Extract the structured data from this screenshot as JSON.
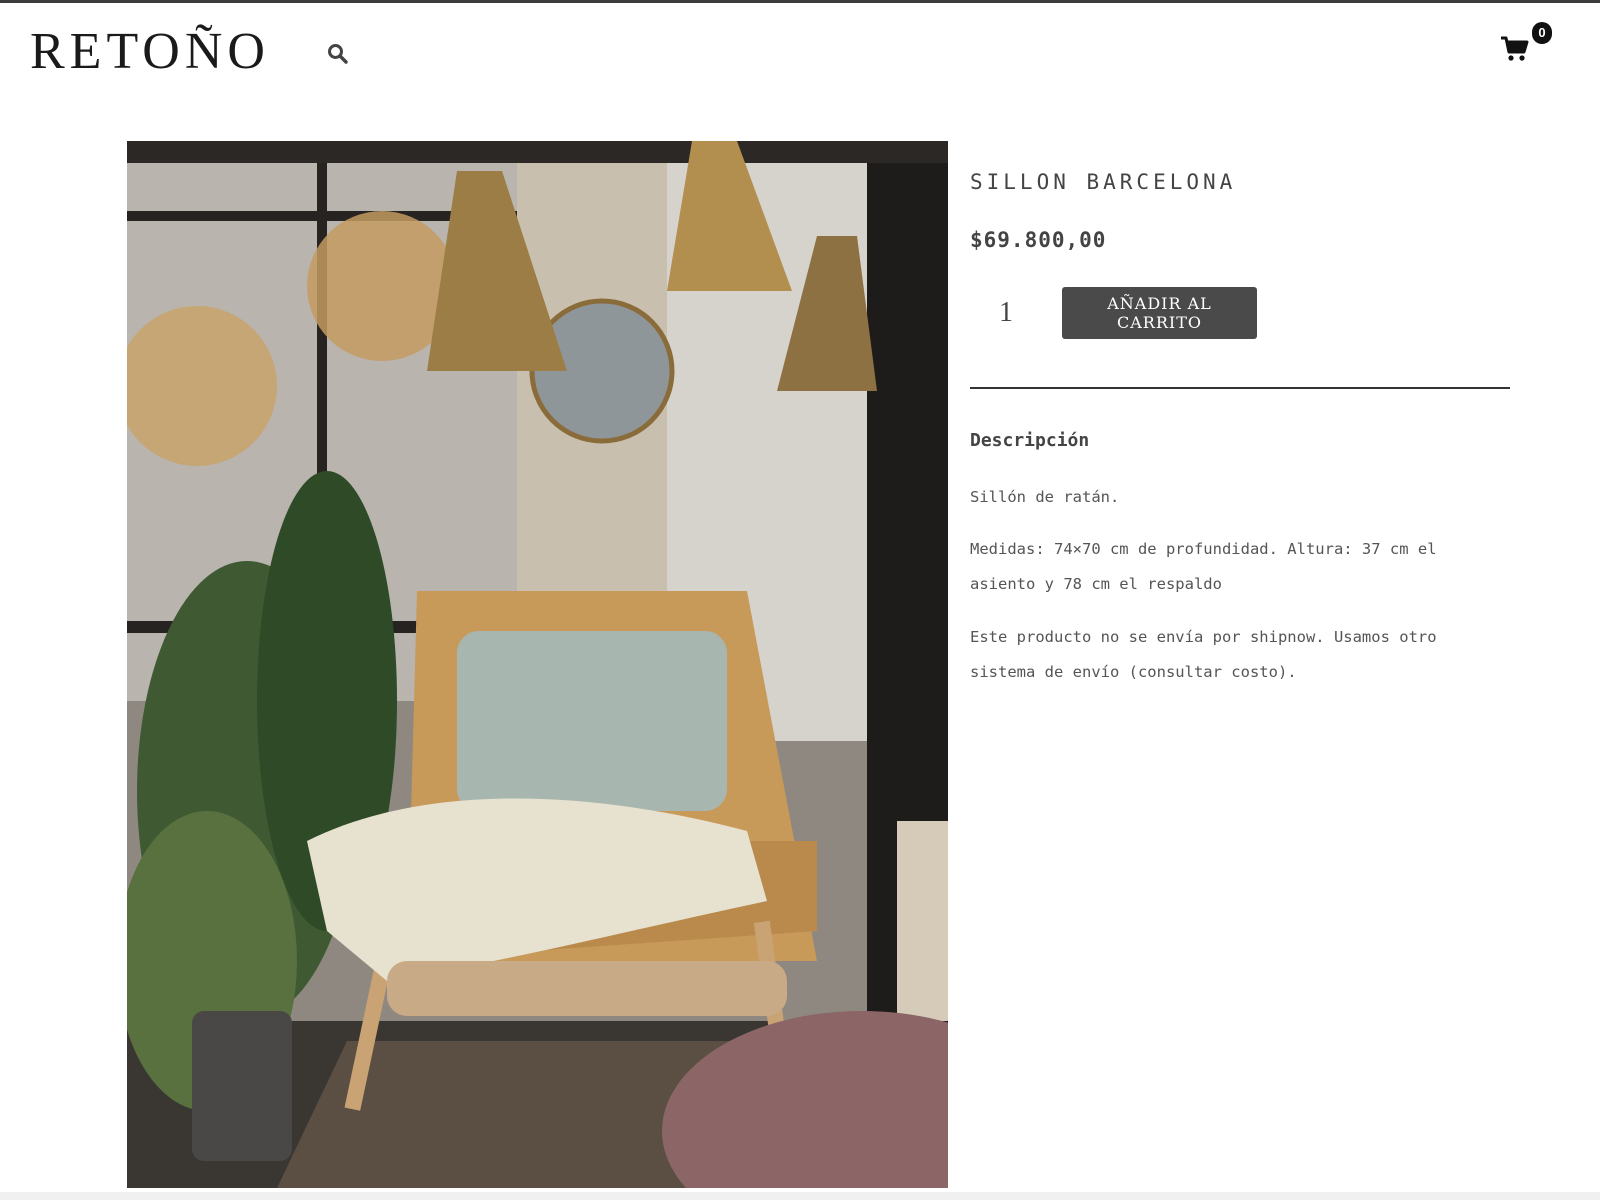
{
  "header": {
    "logo": "RETOÑO",
    "search_icon": "search-icon",
    "cart_icon": "cart-icon",
    "cart_count": "0"
  },
  "product": {
    "title": "SILLON BARCELONA",
    "price": "$69.800,00",
    "quantity": "1",
    "add_to_cart_label": "AÑADIR AL CARRITO",
    "image_alt": ""
  },
  "description": {
    "heading": "Descripción",
    "paragraphs": [
      "Sillón de ratán.",
      "Medidas: 74×70 cm de profundidad. Altura: 37 cm el asiento y 78 cm el respaldo",
      "Este producto no se envía por shipnow. Usamos otro sistema de envío (consultar costo)."
    ]
  },
  "colors": {
    "button_bg": "#4a4a4a",
    "text": "#444444",
    "badge_bg": "#111111"
  }
}
